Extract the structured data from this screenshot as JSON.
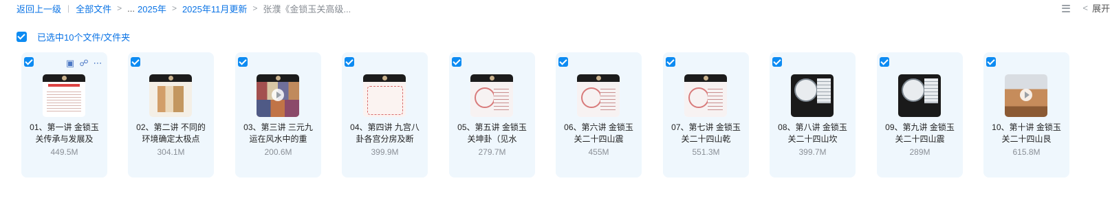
{
  "breadcrumb": {
    "back": "返回上一级",
    "all_files": "全部文件",
    "ellipsis": "...",
    "year": "2025年",
    "month": "2025年11月更新",
    "current": "张濮《金锁玉关高级..."
  },
  "toolbar": {
    "expand": "展开"
  },
  "selection": {
    "text": "已选中10个文件/文件夹"
  },
  "files": [
    {
      "name": "01、第一讲 金锁玉关传承与发展及",
      "size": "449.5M",
      "thumb": "doc-red"
    },
    {
      "name": "02、第二讲 不同的环境确定太极点",
      "size": "304.1M",
      "thumb": "floor"
    },
    {
      "name": "03、第三讲 三元九运在风水中的重",
      "size": "200.6M",
      "thumb": "mosaic"
    },
    {
      "name": "04、第四讲 九宫八卦各宫分房及断",
      "size": "399.9M",
      "thumb": "paper-red"
    },
    {
      "name": "05、第五讲 金锁玉关坤卦（见水",
      "size": "279.7M",
      "thumb": "compass"
    },
    {
      "name": "06、第六讲 金锁玉关二十四山震",
      "size": "455M",
      "thumb": "compass"
    },
    {
      "name": "07、第七讲 金锁玉关二十四山乾",
      "size": "551.3M",
      "thumb": "compass"
    },
    {
      "name": "08、第八讲 金锁玉关二十四山坎",
      "size": "399.7M",
      "thumb": "dark-compass"
    },
    {
      "name": "09、第九讲 金锁玉关二十四山震",
      "size": "289M",
      "thumb": "dark-compass"
    },
    {
      "name": "10、第十讲 金锁玉关二十四山艮",
      "size": "615.8M",
      "thumb": "landscape"
    }
  ]
}
